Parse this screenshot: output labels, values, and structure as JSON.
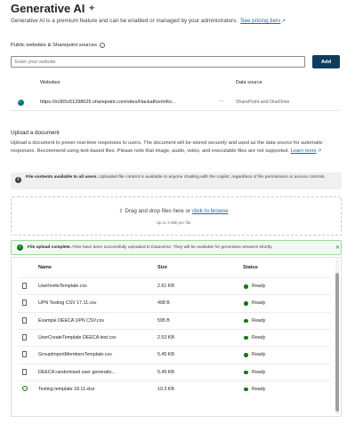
{
  "header": {
    "title": "Generative AI",
    "description": "Generative AI is a premium feature and can be enabled or managed by your administrators.",
    "pricing_link": "See pricing tiers"
  },
  "public_sources": {
    "label": "Public websites & Sharepoint sources",
    "input_placeholder": "Enter your website",
    "add_label": "Add",
    "col_websites": "Websites",
    "col_source": "Data source",
    "rows": [
      {
        "url": "https://m365x51298625.sharepoint.com/sites/HackathonInfor...",
        "dash": "—",
        "source": "SharePoint and OneDrive"
      }
    ]
  },
  "upload": {
    "title": "Upload a document",
    "description": "Upload a document to power real-time responses to users. The document will be stored securely and used as the data source for automatic responses. Recommend using text-based files. Please note that image, audio, video, and executable files are not supported.",
    "learn_more": "Learn more",
    "warning_bold": "File contents available to all users.",
    "warning_text": "Uploaded file content is available to anyone chatting with the copilot, regardless of file permissions or access controls.",
    "drop_text": "Drag and drop files here or",
    "browse_link": "click to browse",
    "limit_text": "Up to 3 MB per file",
    "success_bold": "File upload complete.",
    "success_text": "Files have been successfully uploaded to Dataverse. They will be available for generative answers shortly."
  },
  "files": {
    "col_name": "Name",
    "col_size": "Size",
    "col_status": "Status",
    "status_color": "#107c10",
    "rows": [
      {
        "name": "UserInviteTemplate.csv",
        "size": "2.61 KB",
        "status": "Ready",
        "icon": "file-icon"
      },
      {
        "name": "UPN Testing CSV 17.11.csv",
        "size": "408 B",
        "status": "Ready",
        "icon": "file-icon"
      },
      {
        "name": "Example DEECA UPN CSV.csv",
        "size": "595 B",
        "status": "Ready",
        "icon": "file-icon"
      },
      {
        "name": "UserCreateTemplate DEECA test.csv",
        "size": "2.53 KB",
        "status": "Ready",
        "icon": "file-icon"
      },
      {
        "name": "GroupImportMembersTemplate.csv",
        "size": "5.45 KB",
        "status": "Ready",
        "icon": "file-icon"
      },
      {
        "name": "DEECA randomised user generatio...",
        "size": "5.45 KB",
        "status": "Ready",
        "icon": "file-icon"
      },
      {
        "name": "Testing template 18.11.xlsx",
        "size": "10.3 KB",
        "status": "Ready",
        "icon": "spreadsheet-icon"
      }
    ]
  }
}
